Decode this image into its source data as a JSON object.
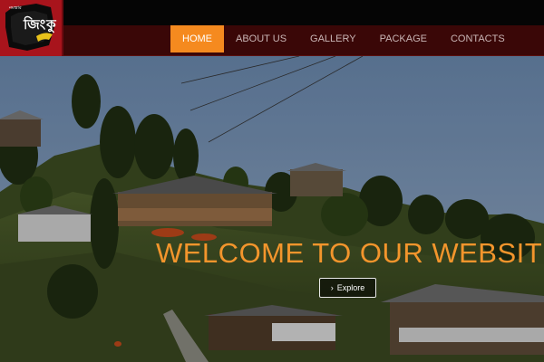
{
  "logo": {
    "text": "জিংকু",
    "small": "নমস্কার"
  },
  "nav": {
    "items": [
      {
        "label": "HOME",
        "active": true
      },
      {
        "label": "ABOUT US",
        "active": false
      },
      {
        "label": "GALLERY",
        "active": false
      },
      {
        "label": "PACKAGE",
        "active": false
      },
      {
        "label": "CONTACTS",
        "active": false
      }
    ]
  },
  "hero": {
    "heading": "WELCOME TO OUR WEBSITE",
    "button_label": "Explore",
    "button_icon": "chevron-right-icon"
  },
  "colors": {
    "accent": "#f58a1f",
    "heading": "#f3952c",
    "navbar": "#3a0707",
    "logo_bg": "#a8141c"
  }
}
